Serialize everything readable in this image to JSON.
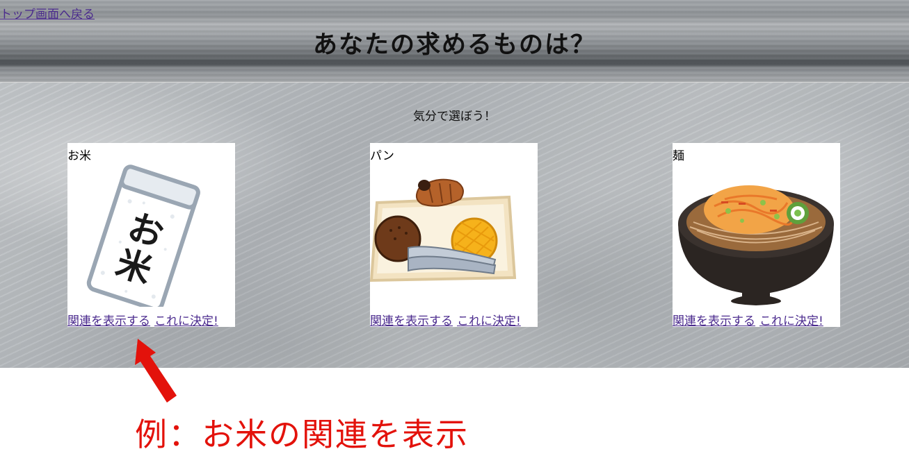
{
  "header": {
    "back_link": "トップ画面へ戻る",
    "title": "あなたの求めるものは？"
  },
  "main": {
    "subtitle": "気分で選ぼう！",
    "cards": [
      {
        "title": "お米",
        "image_icon": "rice-bag-icon",
        "image_text": "お米",
        "related_link": "関連を表示する",
        "decide_link": "これに決定!"
      },
      {
        "title": "パン",
        "image_icon": "bread-tray-icon",
        "related_link": "関連を表示する",
        "decide_link": "これに決定!"
      },
      {
        "title": "麺",
        "image_icon": "noodle-bowl-icon",
        "related_link": "関連を表示する",
        "decide_link": "これに決定!"
      }
    ]
  },
  "annotation": {
    "text": "例：お米の関連を表示",
    "color": "#e3120b"
  },
  "colors": {
    "link": "#4b2b8e",
    "annotation": "#e3120b"
  }
}
